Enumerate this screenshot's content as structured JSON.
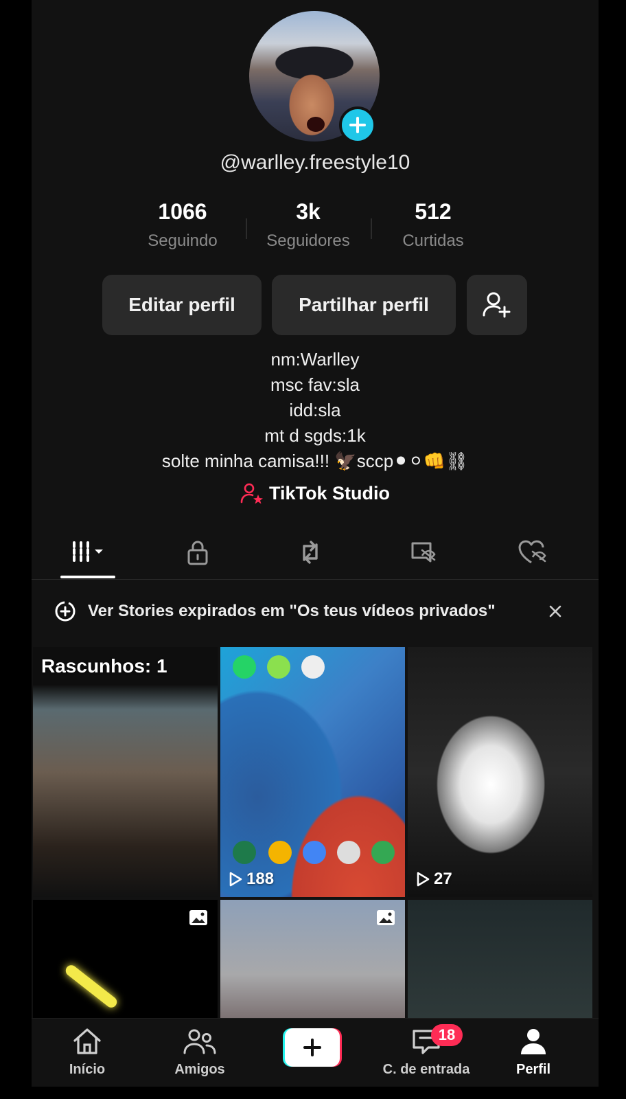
{
  "profile": {
    "username": "@warlley.freestyle10",
    "stats": [
      {
        "value": "1066",
        "label": "Seguindo"
      },
      {
        "value": "3k",
        "label": "Seguidores"
      },
      {
        "value": "512",
        "label": "Curtidas"
      }
    ],
    "buttons": {
      "edit": "Editar perfil",
      "share": "Partilhar perfil"
    },
    "bio": [
      "nm:Warlley",
      "msc fav:sla",
      "idd:sla",
      "mt d sgds:1k",
      "solte minha camisa!!! 🦅sccp⚫⚪👊⛓"
    ],
    "studio_label": "TikTok Studio"
  },
  "banner": {
    "text": "Ver Stories expirados em \"Os teus vídeos privados\""
  },
  "grid": {
    "draft_label": "Rascunhos: 1",
    "items": [
      {
        "views": "188"
      },
      {
        "views": "27"
      }
    ]
  },
  "nav": {
    "home": "Início",
    "friends": "Amigos",
    "inbox": "C. de entrada",
    "inbox_badge": "18",
    "profile": "Perfil"
  },
  "colors": {
    "accent_cyan": "#25f4ee",
    "accent_red": "#fe2c55",
    "avatar_add": "#1fc7e8"
  }
}
